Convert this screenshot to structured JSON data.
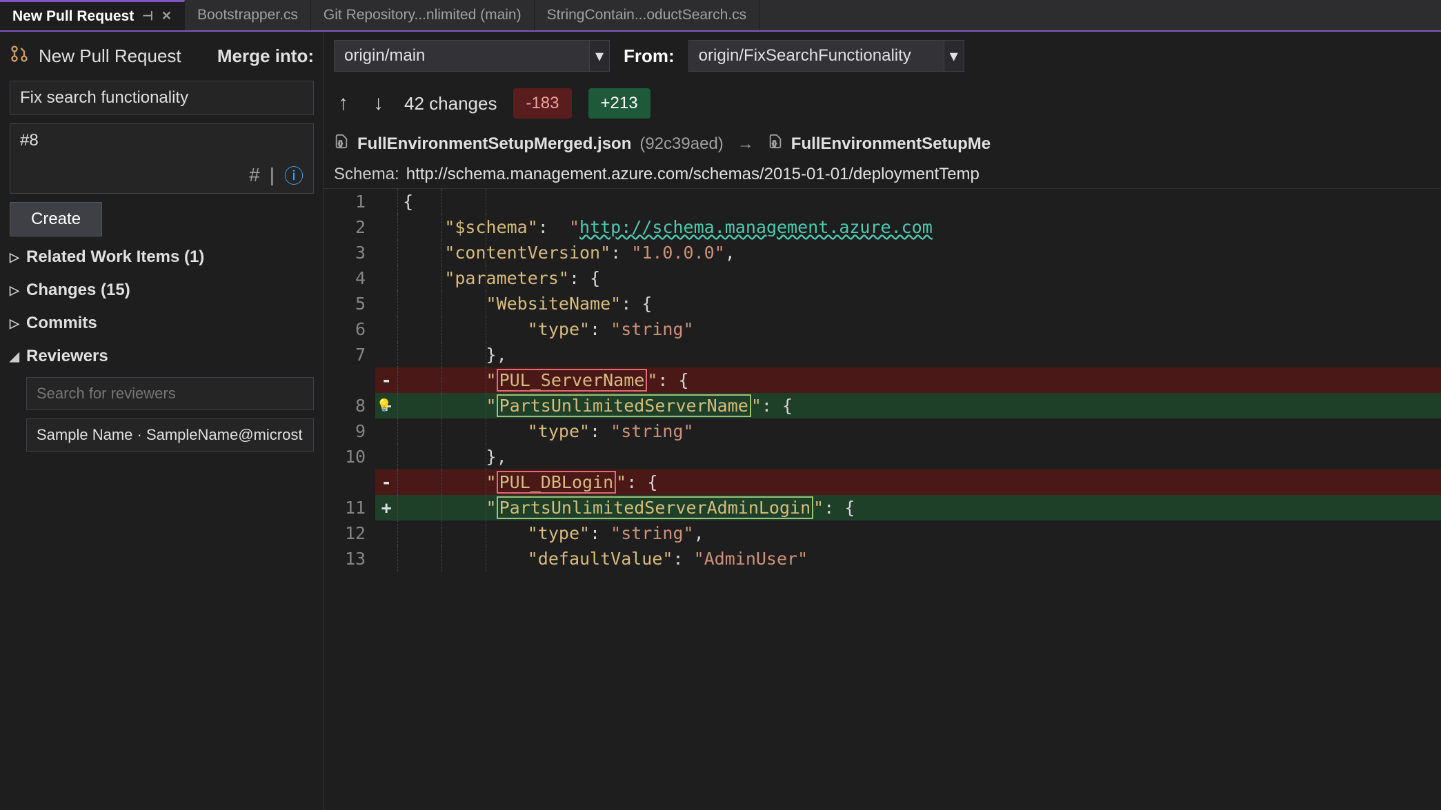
{
  "tabs": [
    {
      "label": "New Pull Request",
      "active": true
    },
    {
      "label": "Bootstrapper.cs"
    },
    {
      "label": "Git Repository...nlimited (main)"
    },
    {
      "label": "StringContain...oductSearch.cs"
    }
  ],
  "sidebar": {
    "title": "New Pull Request",
    "merge_into_label": "Merge into:",
    "pr_title": "Fix search functionality",
    "pr_description": "#8",
    "create_label": "Create",
    "sections": {
      "related": "Related Work Items (1)",
      "changes": "Changes (15)",
      "commits": "Commits",
      "reviewers": "Reviewers"
    },
    "reviewer_search_placeholder": "Search for reviewers",
    "reviewer_item": "Sample Name · SampleName@microst"
  },
  "toprow": {
    "merge_into_value": "origin/main",
    "from_label": "From:",
    "from_value": "origin/FixSearchFunctionality"
  },
  "changes_bar": {
    "count": "42 changes",
    "removed": "-183",
    "added": "+213"
  },
  "file_compare": {
    "left_name": "FullEnvironmentSetupMerged.json",
    "commit": "(92c39aed)",
    "arrow": "→",
    "right_name": "FullEnvironmentSetupMe"
  },
  "schema": {
    "label": "Schema:",
    "url": "http://schema.management.azure.com/schemas/2015-01-01/deploymentTemp"
  },
  "code": {
    "lines": [
      {
        "n": "1",
        "text_html": "<span class='tok-punc'>{</span>"
      },
      {
        "n": "2",
        "text_html": "    <span class='tok-key'>\"$schema\"</span><span class='tok-punc'>:</span>  <span class='tok-str'>\"</span><span class='tok-link'>http://schema.management.azure.com</span>"
      },
      {
        "n": "3",
        "text_html": "    <span class='tok-key'>\"contentVersion\"</span><span class='tok-punc'>:</span> <span class='tok-str'>\"1.0.0.0\"</span><span class='tok-punc'>,</span>"
      },
      {
        "n": "4",
        "text_html": "    <span class='tok-key'>\"parameters\"</span><span class='tok-punc'>:</span> <span class='tok-punc'>{</span>"
      },
      {
        "n": "5",
        "text_html": "        <span class='tok-key'>\"WebsiteName\"</span><span class='tok-punc'>:</span> <span class='tok-punc'>{</span>"
      },
      {
        "n": "6",
        "text_html": "            <span class='tok-key'>\"type\"</span><span class='tok-punc'>:</span> <span class='tok-str'>\"string\"</span>"
      },
      {
        "n": "7",
        "text_html": "        <span class='tok-punc'>},</span>"
      },
      {
        "n": "",
        "diff": "-",
        "cls": "removed",
        "text_html": "        <span class='tok-key'>\"<span class='hl-red'>PUL_ServerName</span>\"</span><span class='tok-punc'>:</span> <span class='tok-punc'>{</span>"
      },
      {
        "n": "8",
        "diff": "+",
        "cls": "added",
        "bulb": true,
        "text_html": "        <span class='tok-key'>\"<span class='hl-green'>PartsUnlimitedServerName</span>\"</span><span class='tok-punc'>:</span> <span class='tok-punc'>{</span>"
      },
      {
        "n": "9",
        "text_html": "            <span class='tok-key'>\"type\"</span><span class='tok-punc'>:</span> <span class='tok-str'>\"string\"</span>"
      },
      {
        "n": "10",
        "text_html": "        <span class='tok-punc'>},</span>"
      },
      {
        "n": "",
        "diff": "-",
        "cls": "removed",
        "text_html": "        <span class='tok-key'>\"<span class='hl-red'>PUL_DBLogin</span>\"</span><span class='tok-punc'>:</span> <span class='tok-punc'>{</span>"
      },
      {
        "n": "11",
        "diff": "+",
        "cls": "added",
        "text_html": "        <span class='tok-key'>\"<span class='hl-green'>PartsUnlimitedServerAdminLogin</span>\"</span><span class='tok-punc'>:</span> <span class='tok-punc'>{</span>"
      },
      {
        "n": "12",
        "text_html": "            <span class='tok-key'>\"type\"</span><span class='tok-punc'>:</span> <span class='tok-str'>\"string\"</span><span class='tok-punc'>,</span>"
      },
      {
        "n": "13",
        "text_html": "            <span class='tok-key'>\"defaultValue\"</span><span class='tok-punc'>:</span> <span class='tok-str'>\"AdminUser\"</span>"
      }
    ]
  }
}
